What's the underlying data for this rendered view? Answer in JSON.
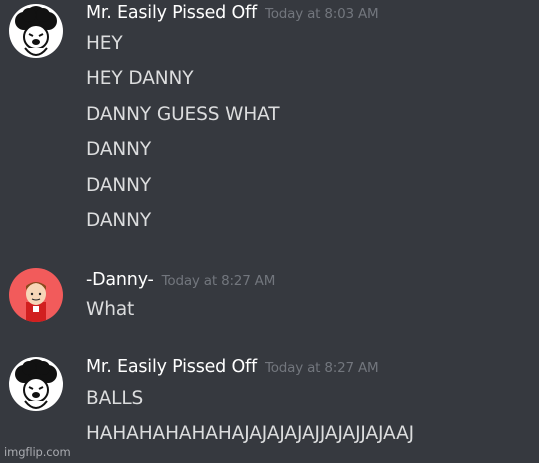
{
  "messages": [
    {
      "username": "Mr. Easily Pissed Off",
      "timestamp": "Today at 8:03 AM",
      "avatar_icon": "cartoon-face-afro-icon",
      "lines": [
        "HEY",
        "HEY DANNY",
        "DANNY GUESS WHAT",
        "DANNY",
        "DANNY",
        "DANNY"
      ]
    },
    {
      "username": "-Danny-",
      "timestamp": "Today at 8:27 AM",
      "avatar_icon": "danny-cartoon-icon",
      "lines": [
        "What"
      ]
    },
    {
      "username": "Mr. Easily Pissed Off",
      "timestamp": "Today at 8:27 AM",
      "avatar_icon": "cartoon-face-afro-icon",
      "lines": [
        "BALLS",
        "HAHAHAHAHAHAJAJAJAJAJJAJAJJAJAAJ"
      ]
    }
  ],
  "watermark": "imgflip.com",
  "colors": {
    "background": "#36393f",
    "username": "#ffffff",
    "timestamp": "#72767d",
    "message_text": "#dcddde",
    "danny_avatar_bg": "#f25b5b"
  }
}
